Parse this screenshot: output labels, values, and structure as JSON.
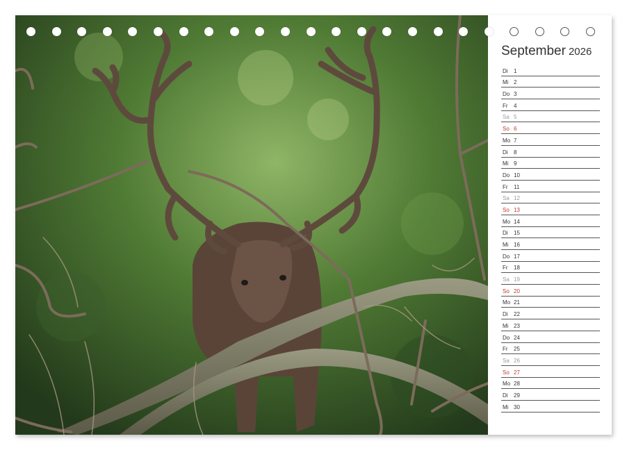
{
  "calendar": {
    "month": "September",
    "year": "2026",
    "days": [
      {
        "dow": "Di",
        "day": "1",
        "type": "weekday"
      },
      {
        "dow": "Mi",
        "day": "2",
        "type": "weekday"
      },
      {
        "dow": "Do",
        "day": "3",
        "type": "weekday"
      },
      {
        "dow": "Fr",
        "day": "4",
        "type": "weekday"
      },
      {
        "dow": "Sa",
        "day": "5",
        "type": "sat"
      },
      {
        "dow": "So",
        "day": "6",
        "type": "sun"
      },
      {
        "dow": "Mo",
        "day": "7",
        "type": "weekday"
      },
      {
        "dow": "Di",
        "day": "8",
        "type": "weekday"
      },
      {
        "dow": "Mi",
        "day": "9",
        "type": "weekday"
      },
      {
        "dow": "Do",
        "day": "10",
        "type": "weekday"
      },
      {
        "dow": "Fr",
        "day": "11",
        "type": "weekday"
      },
      {
        "dow": "Sa",
        "day": "12",
        "type": "sat"
      },
      {
        "dow": "So",
        "day": "13",
        "type": "sun"
      },
      {
        "dow": "Mo",
        "day": "14",
        "type": "weekday"
      },
      {
        "dow": "Di",
        "day": "15",
        "type": "weekday"
      },
      {
        "dow": "Mi",
        "day": "16",
        "type": "weekday"
      },
      {
        "dow": "Do",
        "day": "17",
        "type": "weekday"
      },
      {
        "dow": "Fr",
        "day": "18",
        "type": "weekday"
      },
      {
        "dow": "Sa",
        "day": "19",
        "type": "sat"
      },
      {
        "dow": "So",
        "day": "20",
        "type": "sun"
      },
      {
        "dow": "Mo",
        "day": "21",
        "type": "weekday"
      },
      {
        "dow": "Di",
        "day": "22",
        "type": "weekday"
      },
      {
        "dow": "Mi",
        "day": "23",
        "type": "weekday"
      },
      {
        "dow": "Do",
        "day": "24",
        "type": "weekday"
      },
      {
        "dow": "Fr",
        "day": "25",
        "type": "weekday"
      },
      {
        "dow": "Sa",
        "day": "26",
        "type": "sat"
      },
      {
        "dow": "So",
        "day": "27",
        "type": "sun"
      },
      {
        "dow": "Mo",
        "day": "28",
        "type": "weekday"
      },
      {
        "dow": "Di",
        "day": "29",
        "type": "weekday"
      },
      {
        "dow": "Mi",
        "day": "30",
        "type": "weekday"
      }
    ]
  },
  "binding": {
    "ring_count": 23,
    "icon": "spiral-binding-ring-icon"
  },
  "colors": {
    "sunday": "#c0392b",
    "saturday": "#9a9a9a",
    "text": "#333333",
    "forest_dark": "#2f4a22",
    "forest_light": "#7fa35a"
  }
}
